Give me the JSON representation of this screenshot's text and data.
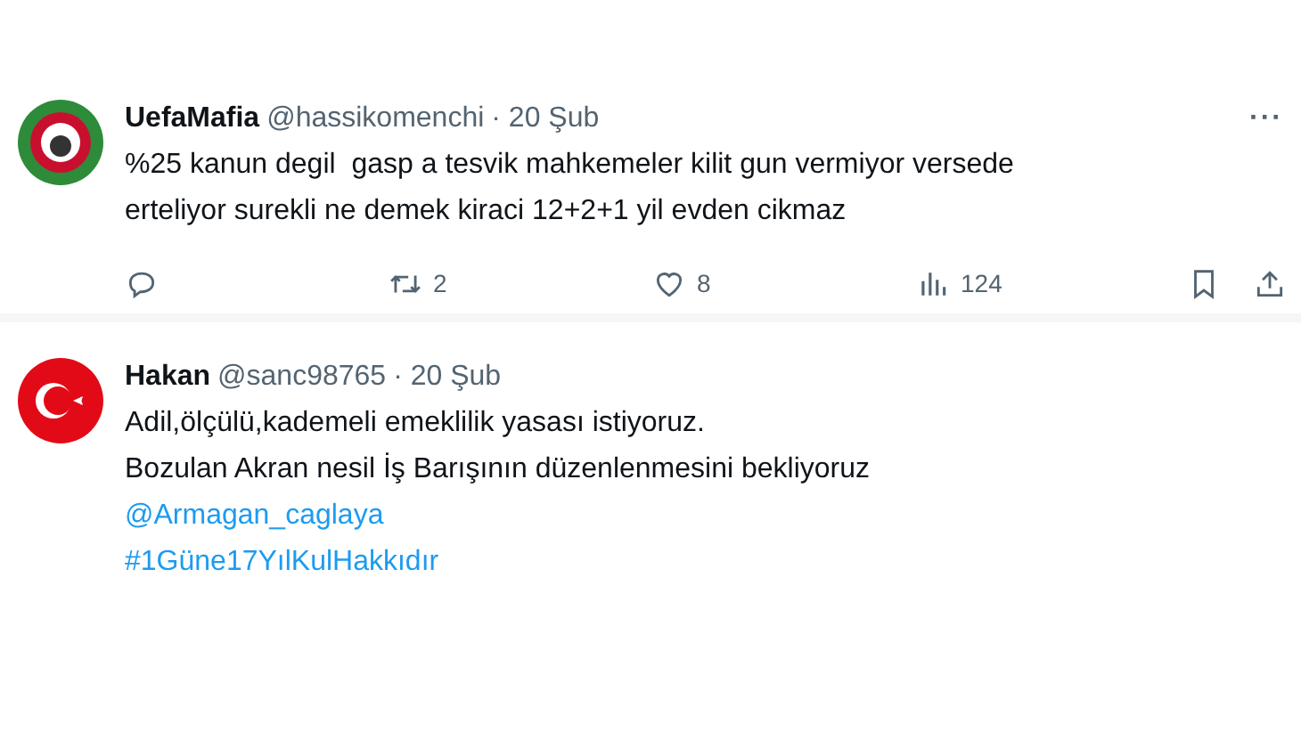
{
  "tweets": [
    {
      "kind": "club",
      "name": "UefaMafia",
      "handle": "@hassikomenchi",
      "date": "· 20 Şub",
      "more": "···",
      "lines": [
        {
          "kind": "text",
          "text": "%25 kanun degil  gasp a tesvik mahkemeler kilit gun vermiyor versede"
        },
        {
          "kind": "text",
          "text": "erteliyor surekli ne demek kiraci 12+2+1 yil evden cikmaz"
        }
      ],
      "actions": [
        {
          "kind": "reply"
        },
        {
          "kind": "repost",
          "count": "2"
        },
        {
          "kind": "like",
          "count": "8"
        },
        {
          "kind": "views",
          "count": "124"
        }
      ]
    },
    {
      "kind": "flag",
      "name": "Hakan",
      "handle": "@sanc98765",
      "date": "· 20 Şub",
      "lines": [
        {
          "kind": "text",
          "text": "Adil,ölçülü,kademeli emeklilik yasası istiyoruz."
        },
        {
          "kind": "text",
          "text": "Bozulan Akran nesil İş Barışının düzenlenmesini bekliyoruz"
        },
        {
          "kind": "link",
          "text": "@Armagan_caglaya"
        },
        {
          "kind": "link",
          "text": "#1Güne17YılKulHakkıdır"
        }
      ]
    }
  ]
}
